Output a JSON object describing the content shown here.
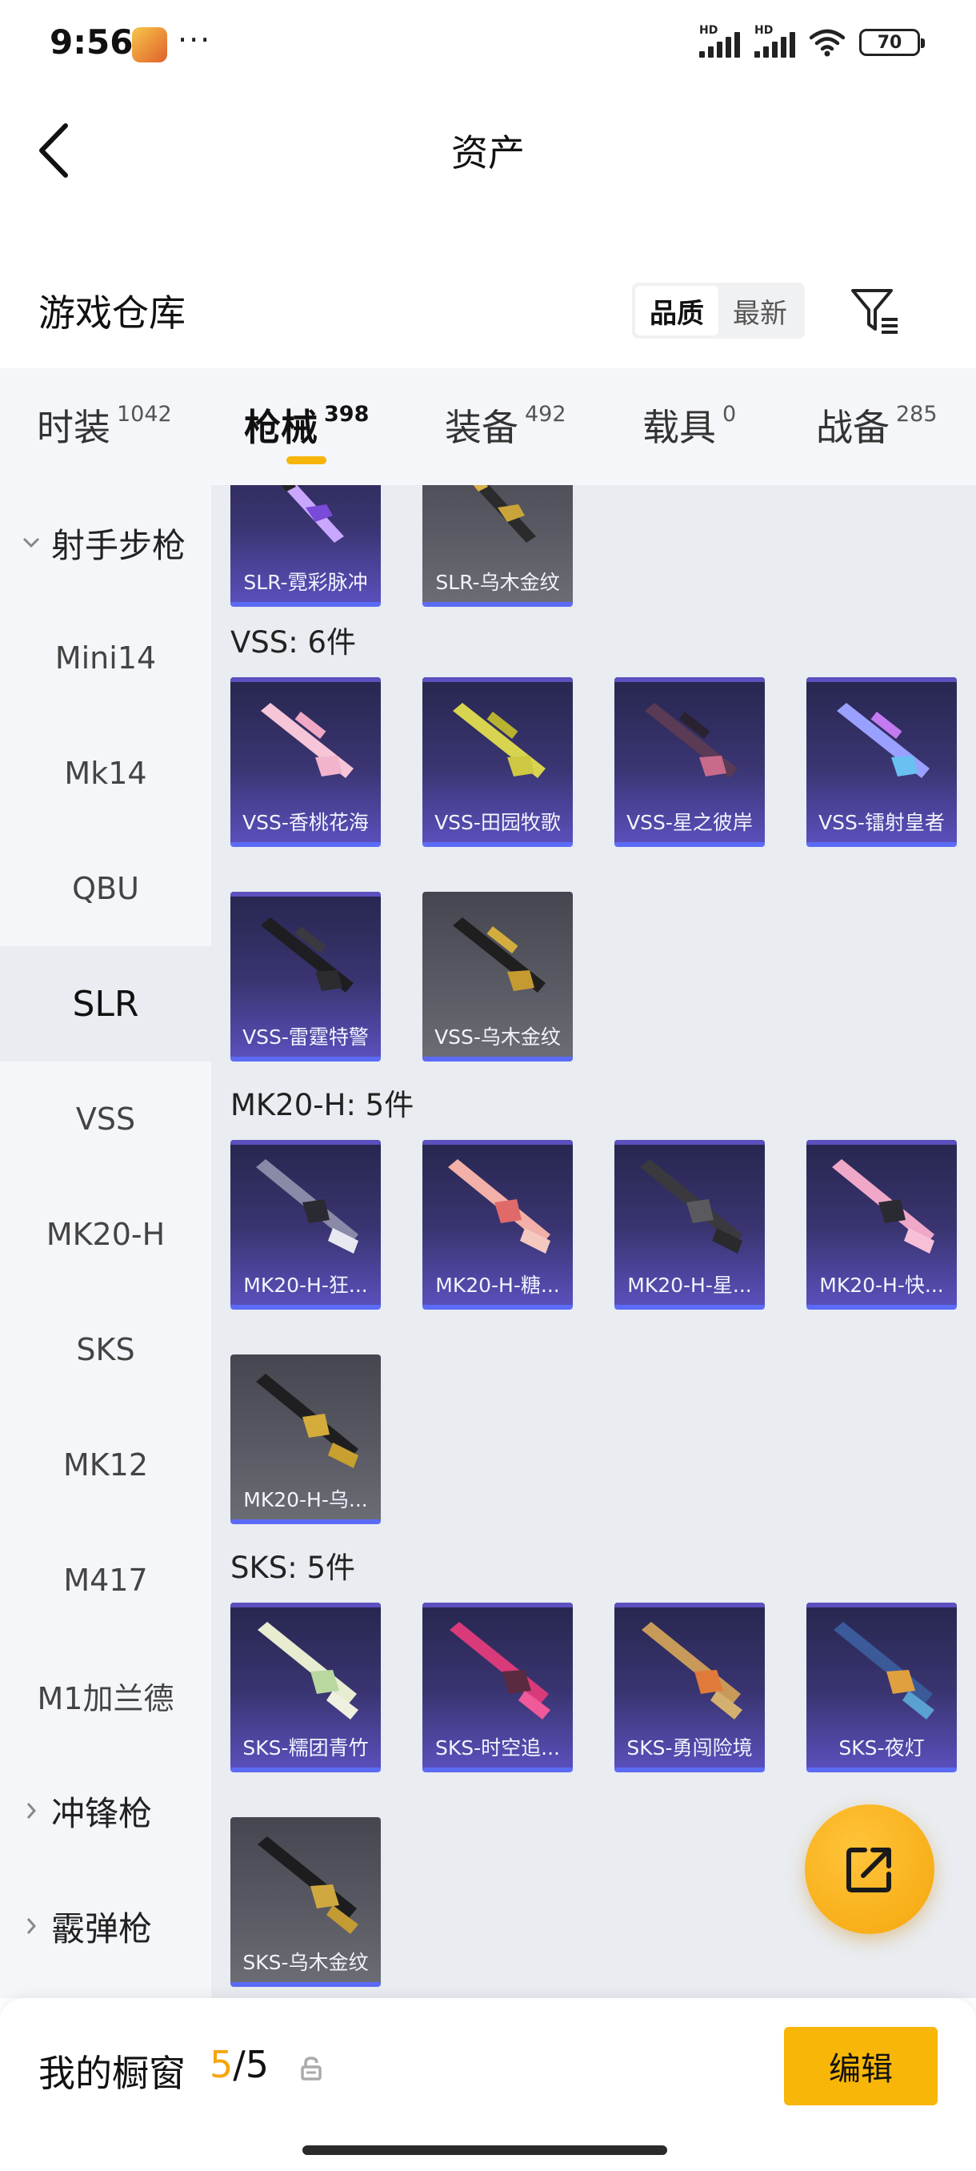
{
  "status": {
    "time": "9:56",
    "dots": "···",
    "hd1": "HD",
    "hd2": "HD",
    "battery": "70"
  },
  "header": {
    "title": "资产"
  },
  "warehouse": {
    "title": "游戏仓库",
    "sort_options": [
      "品质",
      "最新"
    ],
    "active_sort": "品质"
  },
  "tabs": [
    {
      "label": "时装",
      "count": "1042"
    },
    {
      "label": "枪械",
      "count": "398"
    },
    {
      "label": "装备",
      "count": "492"
    },
    {
      "label": "载具",
      "count": "0"
    },
    {
      "label": "战备",
      "count": "285"
    }
  ],
  "sidebar": {
    "group_open": "射手步枪",
    "items": [
      "Mini14",
      "Mk14",
      "QBU",
      "SLR",
      "VSS",
      "MK20-H",
      "SKS",
      "MK12",
      "M417",
      "M1加兰德"
    ],
    "selected": "SLR",
    "groups_closed": [
      "冲锋枪",
      "霰弹枪"
    ]
  },
  "content": {
    "slr_items": [
      "SLR-霓彩脉冲",
      "SLR-乌木金纹"
    ],
    "sections": [
      {
        "title": "VSS: 6件",
        "items": [
          "VSS-香桃花海",
          "VSS-田园牧歌",
          "VSS-星之彼岸",
          "VSS-镭射皇者",
          "VSS-雷霆特警",
          "VSS-乌木金纹"
        ]
      },
      {
        "title": "MK20-H: 5件",
        "items": [
          "MK20-H-狂...",
          "MK20-H-糖...",
          "MK20-H-星...",
          "MK20-H-快...",
          "MK20-H-乌..."
        ]
      },
      {
        "title": "SKS: 5件",
        "items": [
          "SKS-糯团青竹",
          "SKS-时空追...",
          "SKS-勇闯险境",
          "SKS-夜灯",
          "SKS-乌木金纹"
        ]
      }
    ]
  },
  "bottom": {
    "label": "我的橱窗",
    "count_current": "5",
    "count_sep": "/",
    "count_total": "5",
    "edit_label": "编辑"
  },
  "colors": {
    "accent": "#f5b50a",
    "card_purple": "#3a3572",
    "card_gray": "#5a5b64",
    "card_border": "#5b6bf5"
  },
  "icons": [
    "back-arrow-icon",
    "filter-icon",
    "chevron-down-icon",
    "chevron-right-icon",
    "share-icon",
    "lock-icon",
    "wifi-icon",
    "battery-icon",
    "signal-icon"
  ]
}
